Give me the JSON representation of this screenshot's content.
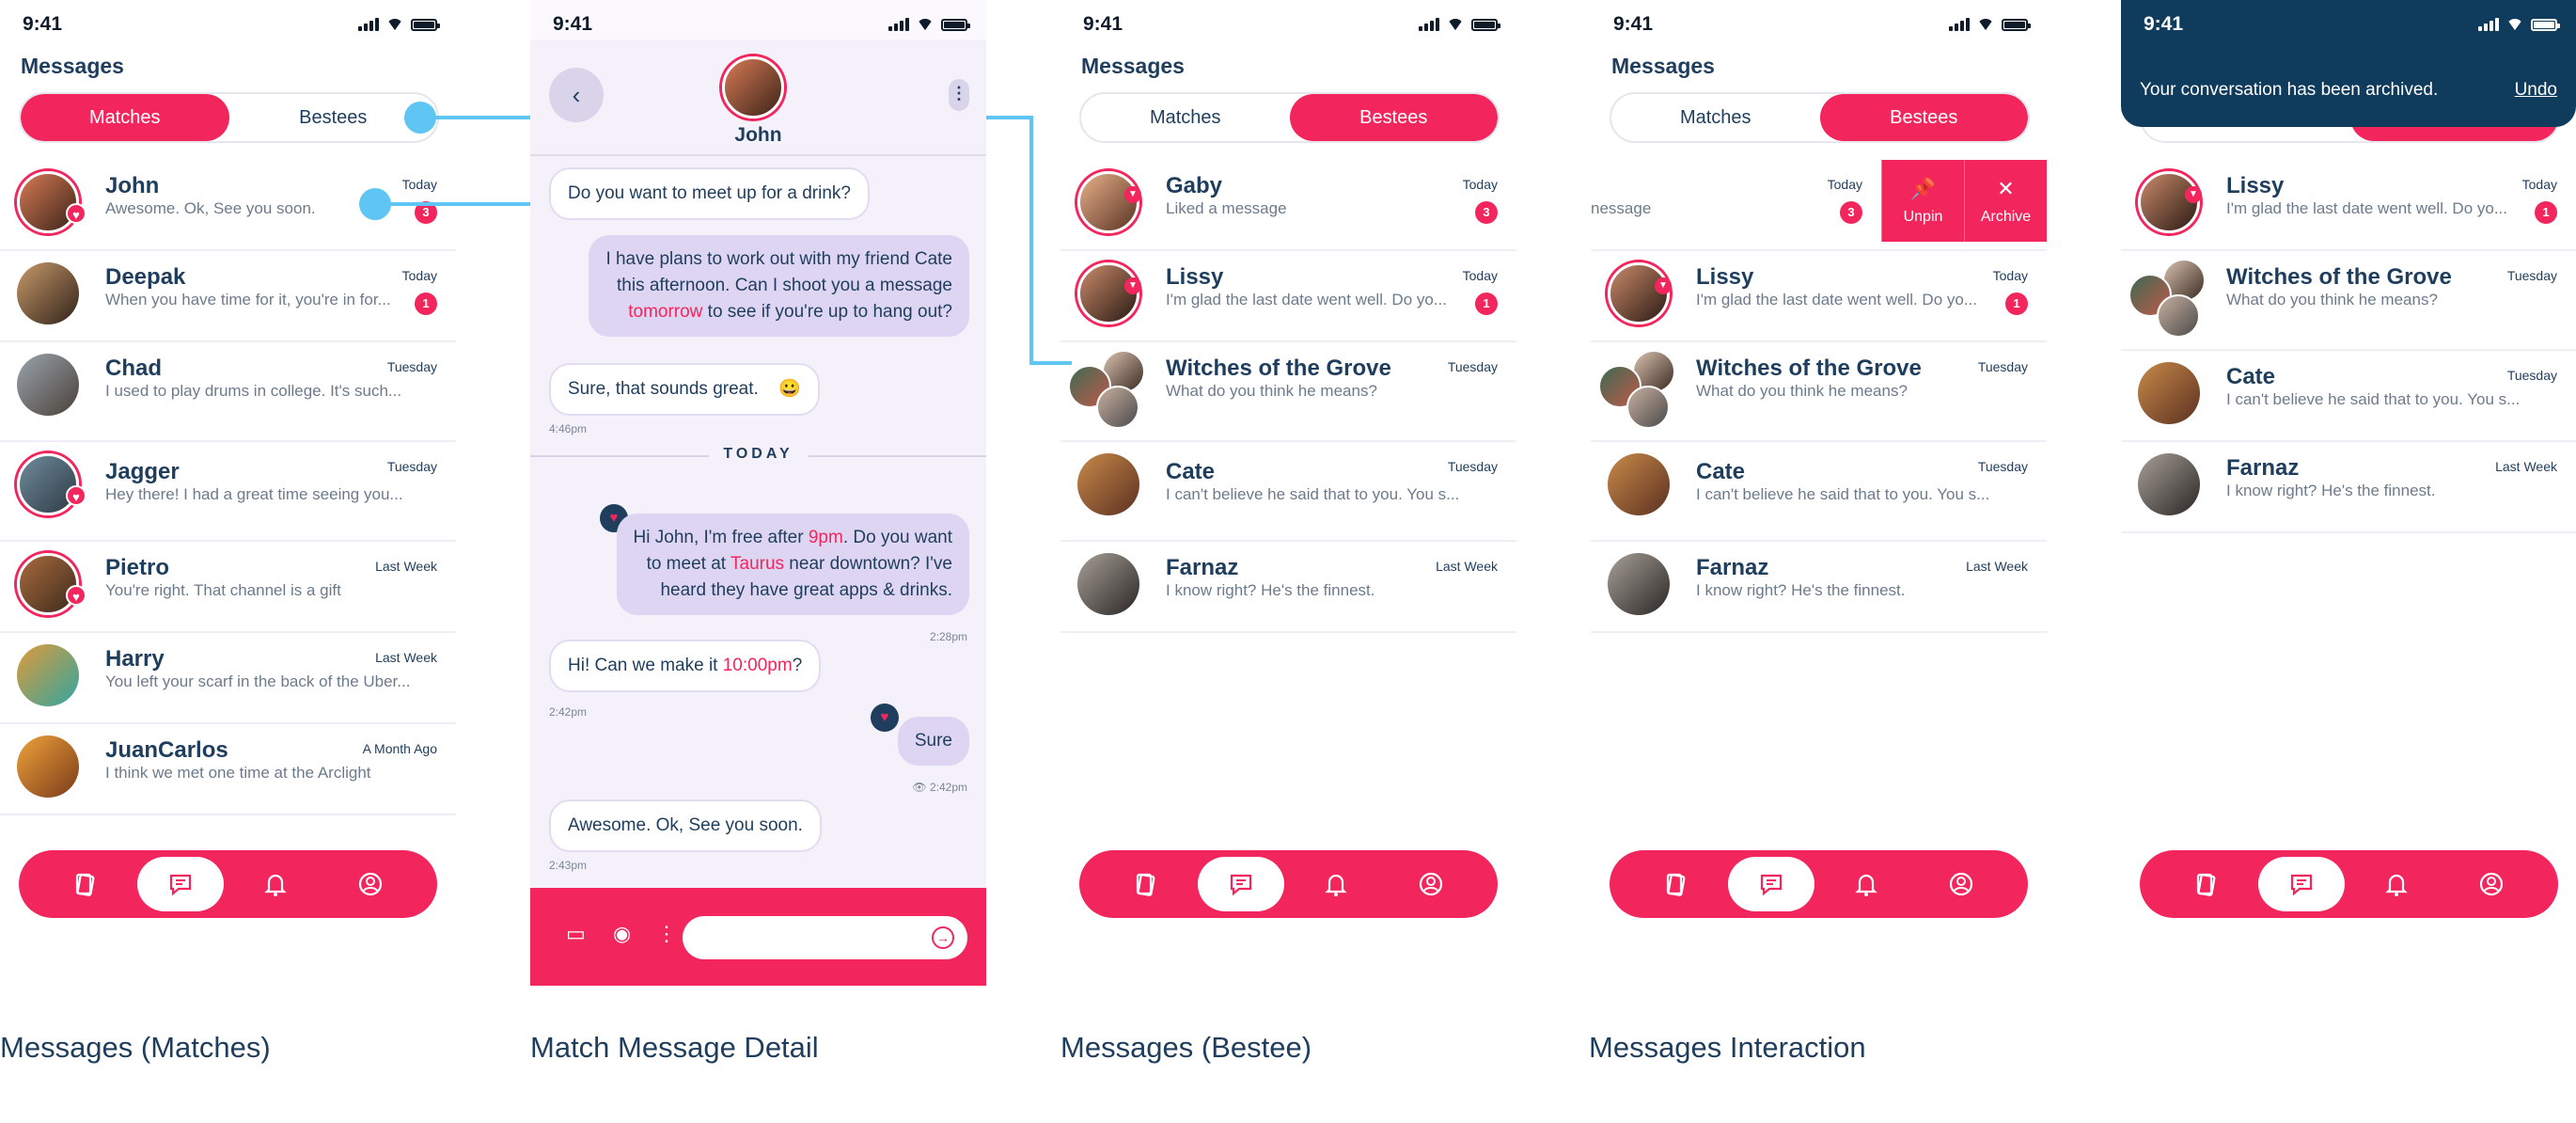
{
  "status": {
    "time": "9:41"
  },
  "screens": {
    "matches": {
      "caption": "Messages (Matches)",
      "title": "Messages",
      "seg_matches": "Matches",
      "seg_bestees": "Bestees",
      "rows": [
        {
          "name": "John",
          "preview": "Awesome. Ok, See you soon.",
          "when": "Today",
          "badge": "3"
        },
        {
          "name": "Deepak",
          "preview": "When you have time for it, you're in for...",
          "when": "Today",
          "badge": "1"
        },
        {
          "name": "Chad",
          "preview": "I used to play drums in college. It's such...",
          "when": "Tuesday",
          "badge": ""
        },
        {
          "name": "Jagger",
          "preview": "Hey there! I had a great time seeing you...",
          "when": "Tuesday",
          "badge": ""
        },
        {
          "name": "Pietro",
          "preview": "You're right. That channel is a gift",
          "when": "Last Week",
          "badge": ""
        },
        {
          "name": "Harry",
          "preview": "You left your scarf in the back of the Uber...",
          "when": "Last Week",
          "badge": ""
        },
        {
          "name": "JuanCarlos",
          "preview": "I think we met one time at the Arclight",
          "when": "A Month Ago",
          "badge": ""
        }
      ]
    },
    "detail": {
      "caption": "Match Message Detail",
      "contact_name": "John",
      "today_label": "TODAY",
      "m1": "Do you want to meet up for a drink?",
      "m2a": "I have plans to work out with my friend Cate",
      "m2b": "this afternoon. Can I shoot you a message",
      "m2c_hl": "tomorrow",
      "m2c": " to see if you're up  to hang out?",
      "m3": "Sure, that sounds great.",
      "m3_emoji": "😀",
      "t3": "4:46pm",
      "m4a_pre": "Hi John, I'm free after ",
      "m4a_hl": "9pm",
      "m4a_post": ". Do you want",
      "m4b_pre": "to meet at ",
      "m4b_hl": "Taurus",
      "m4b_post": " near downtown? I've",
      "m4c": "heard they have great apps & drinks.",
      "t4": "2:28pm",
      "m5_pre": "Hi! Can we make it ",
      "m5_hl": "10:00pm",
      "m5_post": "?",
      "t5": "2:42pm",
      "m6": "Sure",
      "t6": "2:42pm",
      "m7": "Awesome. Ok, See you soon.",
      "t7": "2:43pm"
    },
    "bestees": {
      "caption": "Messages (Bestee)",
      "title": "Messages",
      "seg_matches": "Matches",
      "seg_bestees": "Bestees",
      "rows": [
        {
          "name": "Gaby",
          "preview": "Liked a message",
          "when": "Today",
          "badge": "3"
        },
        {
          "name": "Lissy",
          "preview": "I'm glad the last date went well. Do yo...",
          "when": "Today",
          "badge": "1"
        },
        {
          "name": "Witches of the Grove",
          "preview": "What do you think he means?",
          "when": "Tuesday",
          "badge": ""
        },
        {
          "name": "Cate",
          "preview": "I can't believe he said that to you. You s...",
          "when": "Tuesday",
          "badge": ""
        },
        {
          "name": "Farnaz",
          "preview": "I know right? He's the finnest.",
          "when": "Last Week",
          "badge": ""
        }
      ]
    },
    "interaction": {
      "caption": "Messages Interaction",
      "title": "Messages",
      "seg_matches": "Matches",
      "seg_bestees": "Bestees",
      "swiped_preview": "nessage",
      "swiped_when": "Today",
      "swiped_badge": "3",
      "unpin": "Unpin",
      "archive": "Archive",
      "rows": [
        {
          "name": "Lissy",
          "preview": "I'm glad the last date went well. Do yo...",
          "when": "Today",
          "badge": "1"
        },
        {
          "name": "Witches of the Grove",
          "preview": "What do you think he means?",
          "when": "Tuesday",
          "badge": ""
        },
        {
          "name": "Cate",
          "preview": "I can't believe he said that to you. You s...",
          "when": "Tuesday",
          "badge": ""
        },
        {
          "name": "Farnaz",
          "preview": "I know right? He's the finnest.",
          "when": "Last Week",
          "badge": ""
        }
      ]
    },
    "archived": {
      "toast": "Your conversation has been archived.",
      "undo": "Undo",
      "rows": [
        {
          "name": "Lissy",
          "preview": "I'm glad the last date went well. Do yo...",
          "when": "Today",
          "badge": "1"
        },
        {
          "name": "Witches of the Grove",
          "preview": "What do you think he means?",
          "when": "Tuesday",
          "badge": ""
        },
        {
          "name": "Cate",
          "preview": "I can't believe he said that to you. You s...",
          "when": "Tuesday",
          "badge": ""
        },
        {
          "name": "Farnaz",
          "preview": "I know right? He's the finnest.",
          "when": "Last Week",
          "badge": ""
        }
      ]
    }
  },
  "colors": {
    "accent": "#f2265d",
    "navy": "#1f3d5c",
    "connector": "#5fc5f2",
    "toast": "#0f3b5c"
  },
  "icons": [
    "cards-icon",
    "chat-icon",
    "bell-icon",
    "profile-icon",
    "back-icon",
    "more-icon",
    "video-icon",
    "camera-icon",
    "send-icon",
    "pin-icon",
    "close-icon",
    "heart-icon"
  ]
}
